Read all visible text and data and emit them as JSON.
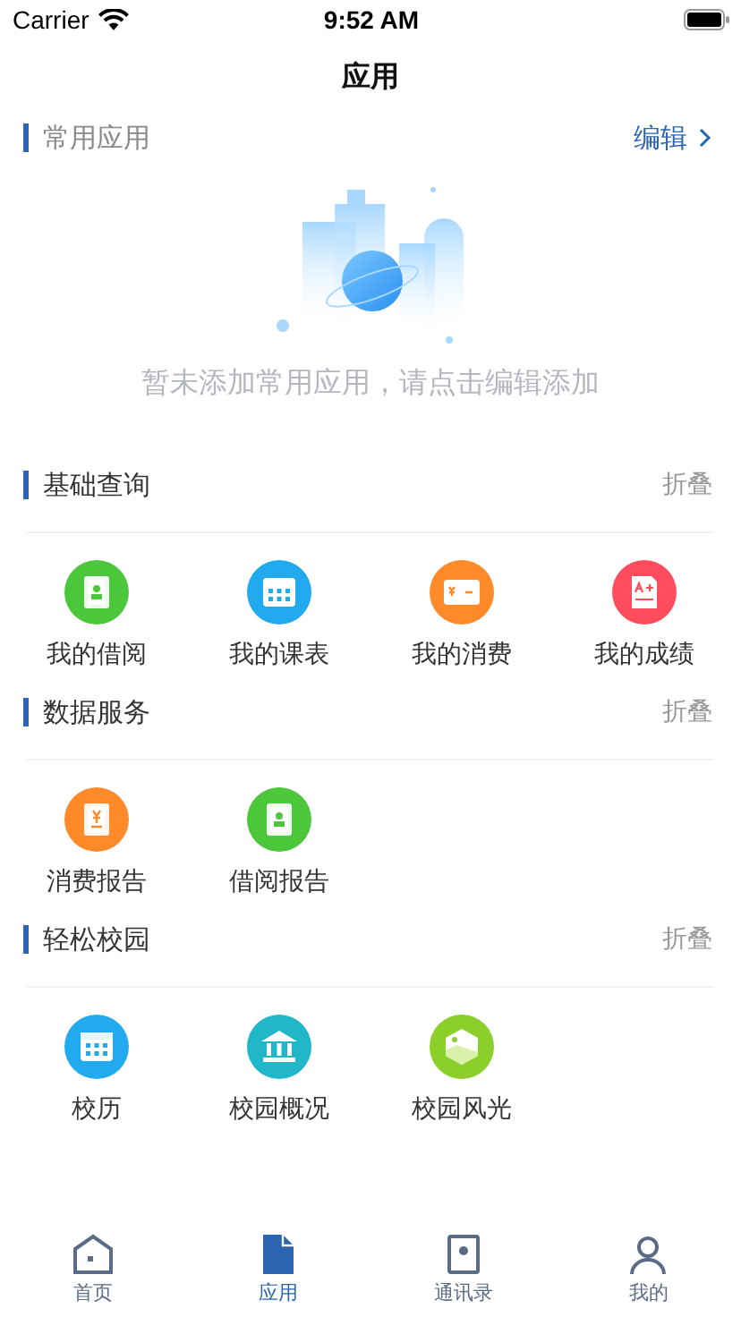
{
  "status_bar": {
    "carrier": "Carrier",
    "time": "9:52 AM"
  },
  "nav": {
    "title": "应用"
  },
  "favorites": {
    "title": "常用应用",
    "action": "编辑",
    "empty_text": "暂未添加常用应用，请点击编辑添加"
  },
  "sections": [
    {
      "title": "基础查询",
      "action": "折叠",
      "apps": [
        {
          "label": "我的借阅",
          "kind": "book",
          "color": "#4cc63a"
        },
        {
          "label": "我的课表",
          "kind": "grid",
          "color": "#22aaee"
        },
        {
          "label": "我的消费",
          "kind": "card",
          "color": "#ff8a2a"
        },
        {
          "label": "我的成绩",
          "kind": "grade",
          "color": "#ff4d5e"
        }
      ]
    },
    {
      "title": "数据服务",
      "action": "折叠",
      "apps": [
        {
          "label": "消费报告",
          "kind": "receipt",
          "color": "#ff8a2a"
        },
        {
          "label": "借阅报告",
          "kind": "book",
          "color": "#4cc63a"
        }
      ]
    },
    {
      "title": "轻松校园",
      "action": "折叠",
      "apps": [
        {
          "label": "校历",
          "kind": "calendar",
          "color": "#22aaee"
        },
        {
          "label": "校园概况",
          "kind": "building",
          "color": "#20b8c8"
        },
        {
          "label": "校园风光",
          "kind": "scenery",
          "color": "#8ccf2a"
        }
      ]
    }
  ],
  "tabs": [
    {
      "label": "首页",
      "kind": "home",
      "selected": false
    },
    {
      "label": "应用",
      "kind": "doc",
      "selected": true
    },
    {
      "label": "通讯录",
      "kind": "contacts",
      "selected": false
    },
    {
      "label": "我的",
      "kind": "person",
      "selected": false
    }
  ]
}
